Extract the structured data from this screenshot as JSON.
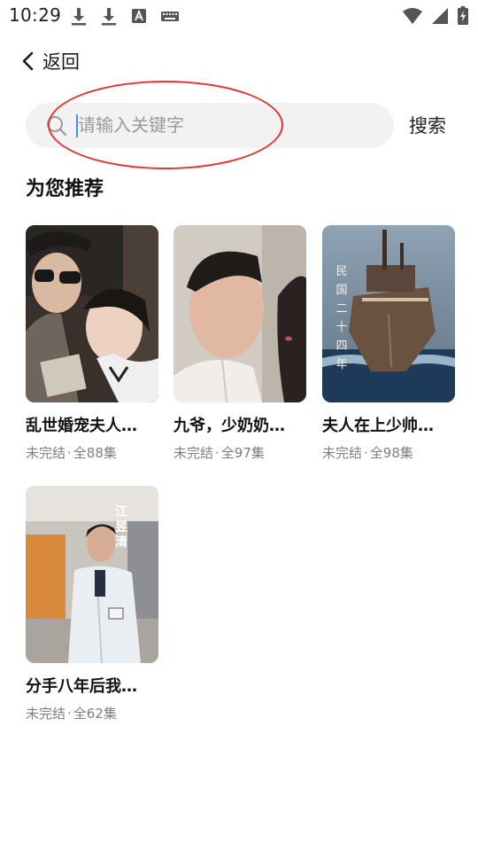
{
  "status_bar": {
    "time": "10:29",
    "left_icons": [
      "download-icon",
      "download-icon",
      "font-icon",
      "keyboard-icon"
    ],
    "right_icons": [
      "wifi-icon",
      "cellular-signal-icon",
      "battery-charging-icon"
    ]
  },
  "header": {
    "back_label": "返回"
  },
  "search": {
    "placeholder": "请输入关键字",
    "value": "",
    "button_label": "搜索",
    "annotation_color": "#e43232"
  },
  "recommend": {
    "title": "为您推荐",
    "items": [
      {
        "title": "乱世婚宠夫人…",
        "status": "未完结",
        "episodes": "全88集"
      },
      {
        "title": "九爷，少奶奶…",
        "status": "未完结",
        "episodes": "全97集"
      },
      {
        "title": "夫人在上少帅…",
        "status": "未完结",
        "episodes": "全98集",
        "poster_text": [
          "民",
          "国",
          "二",
          "十",
          "四",
          "年"
        ]
      },
      {
        "title": "分手八年后我…",
        "status": "未完结",
        "episodes": "全62集",
        "poster_text": [
          "江",
          "昱",
          "清"
        ]
      }
    ]
  },
  "colors": {
    "search_bg": "#f2f2f2",
    "caret": "#4a8df6",
    "meta_text": "#7f7f7f"
  }
}
